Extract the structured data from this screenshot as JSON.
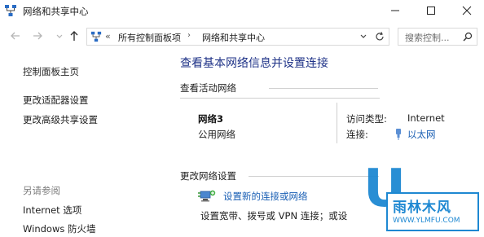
{
  "window": {
    "title": "网络和共享中心"
  },
  "address_bar": {
    "overflow": "«",
    "crumbs": [
      "所有控制面板项",
      "网络和共享中心"
    ],
    "separator": "›"
  },
  "search": {
    "placeholder": "搜索控制..."
  },
  "sidebar": {
    "items": [
      {
        "label": "控制面板主页"
      },
      {
        "label": "更改适配器设置"
      },
      {
        "label": "更改高级共享设置"
      }
    ],
    "see_also_title": "另请参阅",
    "see_also": [
      {
        "label": "Internet 选项"
      },
      {
        "label": "Windows 防火墙"
      }
    ]
  },
  "main": {
    "title": "查看基本网络信息并设置连接",
    "active_networks_heading": "查看活动网络",
    "network": {
      "name": "网络3",
      "type": "公用网络",
      "access_type_label": "访问类型:",
      "access_type_value": "Internet",
      "connection_label": "连接:",
      "connection_value": "以太网"
    },
    "change_heading": "更改网络设置",
    "setup": {
      "link": "设置新的连接或网络",
      "description": "设置宽带、拨号或 VPN 连接；或设"
    }
  },
  "watermark": {
    "big": "U",
    "cn": "雨林木风",
    "url": "WWW.YLMFU.COM"
  },
  "colors": {
    "link": "#1a5fb4",
    "title": "#1e3287",
    "watermark": "#1e88d2"
  }
}
